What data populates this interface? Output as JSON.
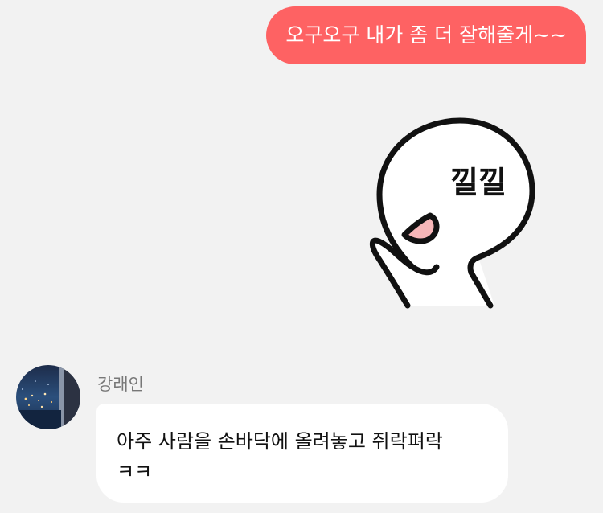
{
  "chat": {
    "sent_message": "오구오구 내가 좀 더 잘해줄게~~",
    "sticker": {
      "icon": "licking-character-sticker-icon",
      "text": "낄낄"
    },
    "received": {
      "sender_name": "강래인",
      "avatar_icon": "night-city-avatar",
      "lines": [
        "아주 사람을 손바닥에 올려놓고 쥐락펴락",
        "ㅋㅋ"
      ]
    }
  },
  "colors": {
    "background": "#f2f2f2",
    "sent_bubble": "#fe6263",
    "received_bubble": "#ffffff",
    "sender_name": "#777777"
  }
}
